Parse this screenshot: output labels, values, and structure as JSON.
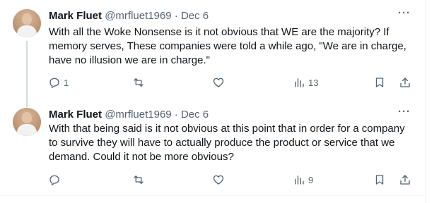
{
  "tweets": [
    {
      "author_name": "Mark Fluet",
      "handle_meta": "@mrfluet1969 · Dec 6",
      "text": "With all the Woke Nonsense is it not obvious that WE are the majority? If memory serves, These companies were told a while ago, \"We are in charge, have no illusion we are in charge.\"",
      "more": "···",
      "stats": {
        "replies": "1",
        "retweets": "",
        "likes": "",
        "views": "13"
      }
    },
    {
      "author_name": "Mark Fluet",
      "handle_meta": "@mrfluet1969 · Dec 6",
      "text": "With that being said is it not obvious at this point that in order for a company to survive they will have to actually produce the product or service that we demand. Could it not be more obvious?",
      "more": "···",
      "stats": {
        "replies": "",
        "retweets": "",
        "likes": "",
        "views": "9"
      }
    }
  ],
  "icons": [
    "reply-icon",
    "retweet-icon",
    "like-icon",
    "views-icon",
    "bookmark-icon",
    "share-icon",
    "more-icon"
  ],
  "colors": {
    "text": "#0f1419",
    "secondary": "#536471",
    "divider": "#eff3f4",
    "thread_line": "#cfd9de"
  }
}
